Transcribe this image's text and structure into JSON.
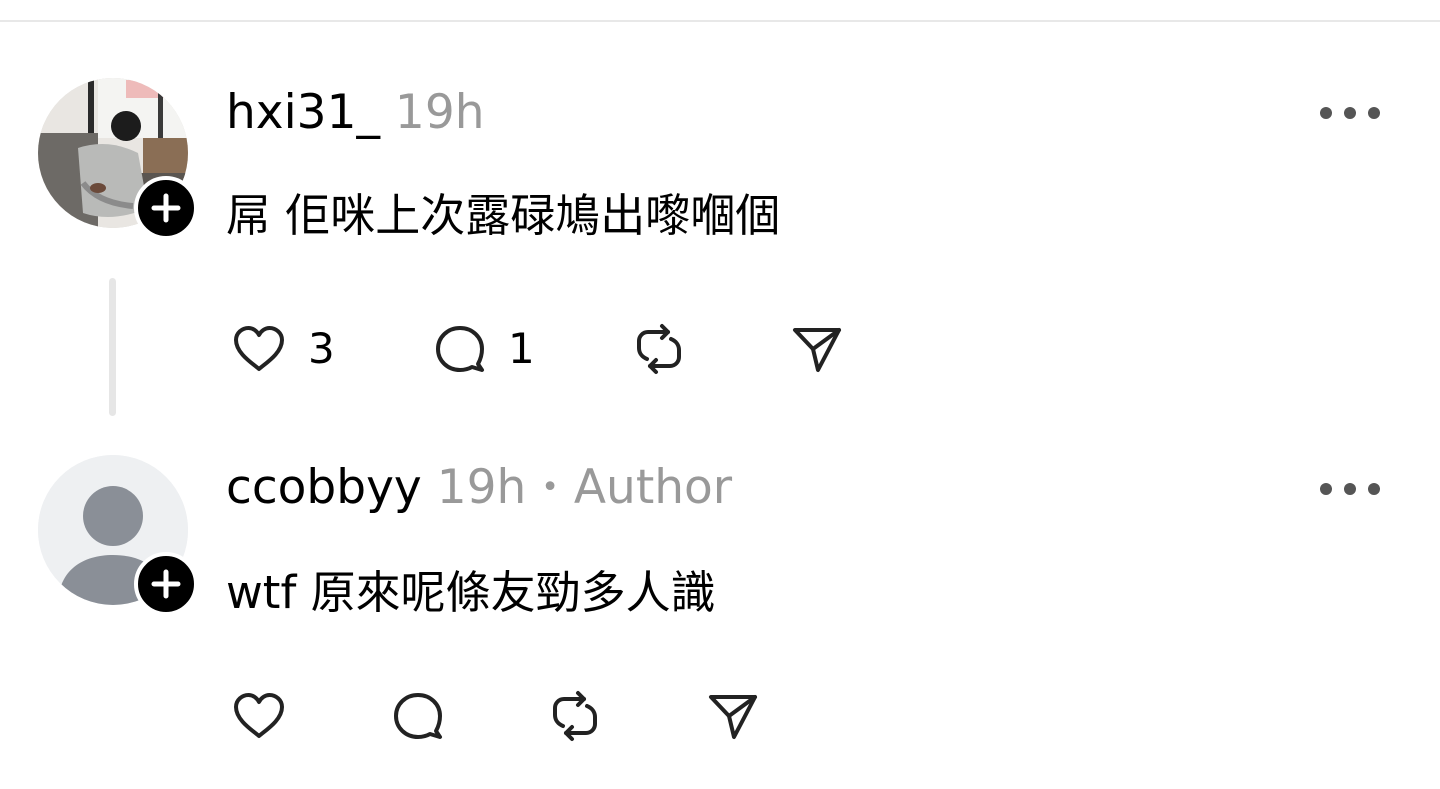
{
  "comments": [
    {
      "username": "hxi31_",
      "time": "19h",
      "author_tag": "",
      "text": "屌 佢咪上次露碌鳩出嚟嗰個",
      "likes": "3",
      "replies": "1",
      "avatar": "photo"
    },
    {
      "username": "ccobbyy",
      "time": "19h",
      "separator": "•",
      "author_tag": "Author",
      "text": "wtf 原來呢條友勁多人識",
      "likes": "",
      "replies": "",
      "avatar": "default"
    }
  ],
  "icons": {
    "like": "heart-icon",
    "reply": "comment-bubble-icon",
    "repost": "repost-icon",
    "share": "send-icon",
    "more": "more-dots-icon",
    "follow": "plus-icon"
  },
  "colors": {
    "text": "#000000",
    "muted": "#999999",
    "divider": "#e8e8e8",
    "thread_line": "#e6e6e6",
    "icon": "#222222"
  }
}
